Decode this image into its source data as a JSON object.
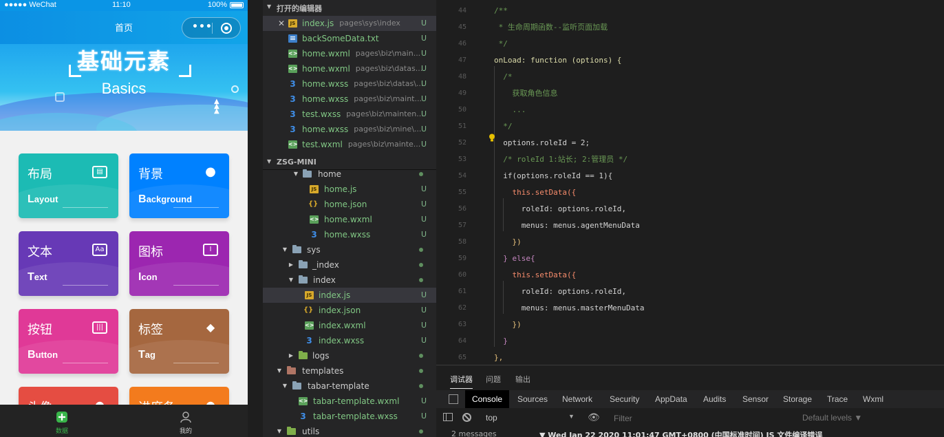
{
  "phone": {
    "status_left": "●●●●● WeChat",
    "status_time": "11:10",
    "status_battery": "100%",
    "nav_title": "首页",
    "banner_cn": "基础元素",
    "banner_en": "Basics",
    "cards": [
      {
        "cn": "布局",
        "en_first": "L",
        "en_rest": "ayout",
        "icon": "layout-icon",
        "color": "#1cbbb4"
      },
      {
        "cn": "背景",
        "en_first": "B",
        "en_rest": "ackground",
        "icon": "palette-icon",
        "color": "#0081ff"
      },
      {
        "cn": "文本",
        "en_first": "T",
        "en_rest": "ext",
        "icon": "text-icon",
        "color": "#6739b6"
      },
      {
        "cn": "图标",
        "en_first": "I",
        "en_rest": "con",
        "icon": "icon-icon",
        "color": "#9c26b0"
      },
      {
        "cn": "按钮",
        "en_first": "B",
        "en_rest": "utton",
        "icon": "button-icon",
        "color": "#e03997"
      },
      {
        "cn": "标签",
        "en_first": "T",
        "en_rest": "ag",
        "icon": "tag-icon",
        "color": "#a5673f"
      },
      {
        "cn": "头像",
        "icon": "avatar-icon",
        "color": "#e54d42"
      },
      {
        "cn": "进度条",
        "icon": "progress-icon",
        "color": "#f37b1d"
      }
    ],
    "tabs": [
      {
        "label": "数据",
        "color": "#39b54a"
      },
      {
        "label": "我的",
        "color": "#aaaaaa"
      }
    ]
  },
  "explorer": {
    "open_editors_title": "打开的编辑器",
    "project_title": "ZSG-MINI",
    "open_editors": [
      {
        "name": "index.js",
        "dir": "pages\\sys\\index",
        "type": "js",
        "status": "U",
        "selected": true
      },
      {
        "name": "backSomeData.txt",
        "dir": "",
        "type": "txt",
        "status": "U"
      },
      {
        "name": "home.wxml",
        "dir": "pages\\biz\\main...",
        "type": "wxml",
        "status": "U"
      },
      {
        "name": "home.wxml",
        "dir": "pages\\biz\\datas...",
        "type": "wxml",
        "status": "U"
      },
      {
        "name": "home.wxss",
        "dir": "pages\\biz\\datas\\...",
        "type": "wxss",
        "status": "U"
      },
      {
        "name": "home.wxss",
        "dir": "pages\\biz\\maint...",
        "type": "wxss",
        "status": "U"
      },
      {
        "name": "test.wxss",
        "dir": "pages\\biz\\mainten...",
        "type": "wxss",
        "status": "U"
      },
      {
        "name": "home.wxss",
        "dir": "pages\\biz\\mine\\...",
        "type": "wxss",
        "status": "U"
      },
      {
        "name": "test.wxml",
        "dir": "pages\\biz\\mainte...",
        "type": "wxml",
        "status": "U"
      }
    ],
    "tree": [
      {
        "name": "home",
        "type": "folder",
        "expanded": true,
        "status": "dot"
      },
      {
        "name": "home.js",
        "type": "js",
        "status": "U"
      },
      {
        "name": "home.json",
        "type": "json",
        "status": "U"
      },
      {
        "name": "home.wxml",
        "type": "wxml",
        "status": "U"
      },
      {
        "name": "home.wxss",
        "type": "wxss",
        "status": "U"
      },
      {
        "name": "sys",
        "type": "folder",
        "expanded": true,
        "status": "dot"
      },
      {
        "name": "_index",
        "type": "folder",
        "expanded": false,
        "status": "dot"
      },
      {
        "name": "index",
        "type": "folder",
        "expanded": true,
        "status": "dot"
      },
      {
        "name": "index.js",
        "type": "js",
        "status": "U",
        "selected": true
      },
      {
        "name": "index.json",
        "type": "json",
        "status": "U"
      },
      {
        "name": "index.wxml",
        "type": "wxml",
        "status": "U"
      },
      {
        "name": "index.wxss",
        "type": "wxss",
        "status": "U"
      },
      {
        "name": "logs",
        "type": "folder-logs",
        "expanded": false,
        "status": "dot"
      },
      {
        "name": "templates",
        "type": "folder-tpl",
        "expanded": true,
        "status": "dot"
      },
      {
        "name": "tabar-template",
        "type": "folder",
        "expanded": true,
        "status": "dot"
      },
      {
        "name": "tabar-template.wxml",
        "type": "wxml",
        "status": "U"
      },
      {
        "name": "tabar-template.wxss",
        "type": "wxss",
        "status": "U"
      },
      {
        "name": "utils",
        "type": "folder-logs",
        "expanded": true,
        "status": "dot"
      }
    ]
  },
  "editor": {
    "lines": [
      {
        "num": "44",
        "text": "/**"
      },
      {
        "num": "45",
        "text": " * 生命周期函数--监听页面加载"
      },
      {
        "num": "46",
        "text": " */"
      },
      {
        "num": "47",
        "text": "onLoad: function (options) {"
      },
      {
        "num": "48",
        "text": "  /*"
      },
      {
        "num": "49",
        "text": "    获取角色信息"
      },
      {
        "num": "50",
        "text": "    ..."
      },
      {
        "num": "51",
        "text": "  */"
      },
      {
        "num": "52",
        "text": "  options.roleId = 2;"
      },
      {
        "num": "53",
        "text": "  /* roleId 1:站长; 2:管理员 */"
      },
      {
        "num": "54",
        "text": "  if(options.roleId == 1){"
      },
      {
        "num": "55",
        "text": "    this.setData({"
      },
      {
        "num": "56",
        "text": "      roleId: options.roleId,"
      },
      {
        "num": "57",
        "text": "      menus: menus.agentMenuData"
      },
      {
        "num": "58",
        "text": "    })"
      },
      {
        "num": "59",
        "text": "  } else{"
      },
      {
        "num": "60",
        "text": "    this.setData({"
      },
      {
        "num": "61",
        "text": "      roleId: options.roleId,"
      },
      {
        "num": "62",
        "text": "      menus: menus.masterMenuData"
      },
      {
        "num": "63",
        "text": "    })"
      },
      {
        "num": "64",
        "text": "  }"
      },
      {
        "num": "65",
        "text": "},"
      }
    ]
  },
  "panel": {
    "tabs": [
      "调试器",
      "问题",
      "输出"
    ],
    "devtools_tabs": [
      "Console",
      "Sources",
      "Network",
      "Security",
      "AppData",
      "Audits",
      "Sensor",
      "Storage",
      "Trace",
      "Wxml"
    ],
    "context": "top",
    "filter_placeholder": "Filter",
    "levels": "Default levels ▼",
    "messages_count": "2 messages",
    "message_text": "▼ Wed Jan 22 2020 11:01:47 GMT+0800 (中国标准时间) JS 文件编译错误"
  }
}
